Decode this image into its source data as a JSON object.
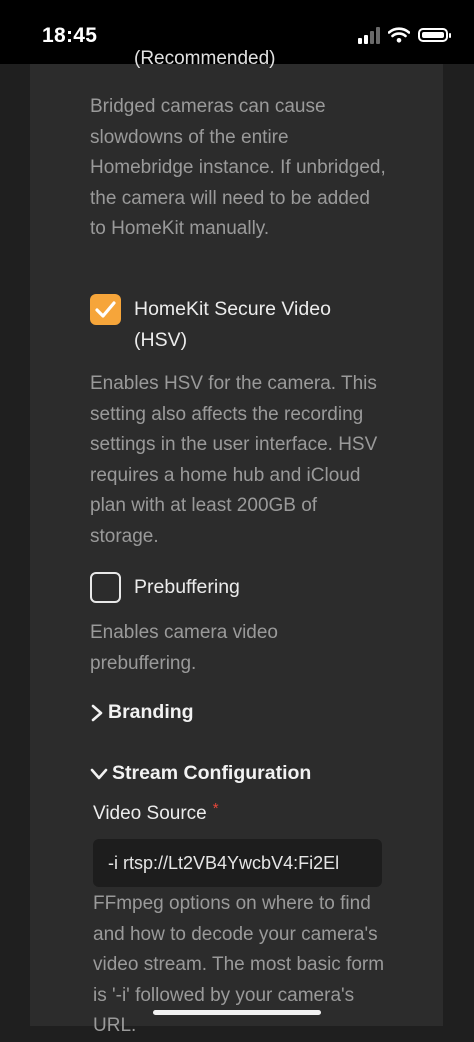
{
  "status_bar": {
    "time": "18:45"
  },
  "settings": {
    "cut_off_label": "(Recommended)",
    "unbridged_description": "Bridged cameras can cause slowdowns of the entire Homebridge instance. If unbridged, the camera will need to be added to HomeKit manually.",
    "hsv": {
      "label": "HomeKit Secure Video (HSV)",
      "checked": true,
      "description": "Enables HSV for the camera. This setting also affects the recording settings in the user interface. HSV requires a home hub and iCloud plan with at least 200GB of storage."
    },
    "prebuffering": {
      "label": "Prebuffering",
      "checked": false,
      "description": "Enables camera video prebuffering."
    },
    "branding": {
      "label": "Branding",
      "expanded": false
    },
    "stream_configuration": {
      "label": "Stream Configuration",
      "expanded": true
    },
    "video_source": {
      "label": "Video Source",
      "required_marker": "*",
      "value": "-i rtsp://Lt2VB4YwcbV4:Fi2El",
      "description": "FFmpeg options on where to find and how to decode your camera's video stream. The most basic form is '-i' followed by your camera's URL."
    }
  },
  "colors": {
    "accent": "#f6a53a",
    "required": "#e8473a",
    "panel": "#2c2c2c",
    "background": "#1f1f1f"
  }
}
